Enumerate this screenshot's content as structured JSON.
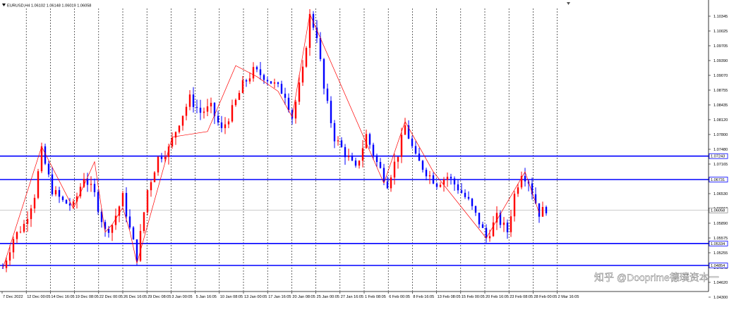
{
  "window": {
    "symbol_line": "EURUSD,H4 1.06102 1.06148 1.06019 1.06058",
    "menu_icon": "triangle-down-icon"
  },
  "colors": {
    "bull": "#ff0000",
    "bear": "#0000ff",
    "zigzag": "#ff0000",
    "level_line": "#0000ff",
    "grid": "#000000",
    "background": "#ffffff"
  },
  "price_axis": {
    "ticks": [
      "1.10345",
      "1.10025",
      "1.09705",
      "1.09390",
      "1.09070",
      "1.08755",
      "1.08435",
      "1.08120",
      "1.07800",
      "1.07480",
      "1.07165",
      "1.06845",
      "1.06530",
      "1.06210",
      "1.05890",
      "1.05575",
      "1.05255",
      "1.04940",
      "1.04620",
      "1.04300"
    ]
  },
  "time_axis": {
    "ticks": [
      "7 Dec 2022",
      "12 Dec 00:05",
      "14 Dec 16:05",
      "19 Dec 08:05",
      "22 Dec 00:05",
      "26 Dec 16:05",
      "29 Dec 08:05",
      "3 Jan 00:05",
      "5 Jan 16:05",
      "10 Jan 08:05",
      "13 Jan 00:05",
      "17 Jan 16:05",
      "20 Jan 08:05",
      "25 Jan 00:05",
      "27 Jan 16:05",
      "1 Feb 08:05",
      "6 Feb 00:05",
      "8 Feb 16:05",
      "13 Feb 08:05",
      "15 Feb 00:05",
      "20 Feb 16:05",
      "23 Feb 08:05",
      "28 Feb 00:05",
      "2 Mar 16:05"
    ]
  },
  "levels": [
    {
      "label": "1.07243",
      "price": 1.07243
    },
    {
      "label": "1.06731",
      "price": 1.06731
    },
    {
      "label": "1.05334",
      "price": 1.05334
    },
    {
      "label": "1.04854",
      "price": 1.04854
    }
  ],
  "current_price": {
    "label": "1.06058",
    "price": 1.06058
  },
  "watermark": "知乎 @Dooprime德璞资本一",
  "chart_data": {
    "type": "candlestick",
    "symbol": "EURUSD",
    "timeframe": "H4",
    "ohlc_header": {
      "open": 1.06102,
      "high": 1.06148,
      "low": 1.06019,
      "close": 1.06058
    },
    "ylim": [
      1.043,
      1.1047
    ],
    "price_path": [
      [
        0,
        1.048
      ],
      [
        3,
        1.0545
      ],
      [
        6,
        1.0575
      ],
      [
        9,
        1.064
      ],
      [
        11,
        1.0735
      ],
      [
        14,
        1.065
      ],
      [
        17,
        1.0625
      ],
      [
        20,
        1.0615
      ],
      [
        23,
        1.068
      ],
      [
        26,
        1.064
      ],
      [
        29,
        1.056
      ],
      [
        31,
        1.0575
      ],
      [
        34,
        1.0635
      ],
      [
        36,
        1.0565
      ],
      [
        38,
        1.0505
      ],
      [
        41,
        1.065
      ],
      [
        44,
        1.072
      ],
      [
        47,
        1.074
      ],
      [
        50,
        1.08
      ],
      [
        53,
        1.085
      ],
      [
        56,
        1.082
      ],
      [
        59,
        1.083
      ],
      [
        62,
        1.078
      ],
      [
        65,
        1.0825
      ],
      [
        68,
        1.088
      ],
      [
        71,
        1.091
      ],
      [
        74,
        1.09
      ],
      [
        77,
        1.088
      ],
      [
        80,
        1.086
      ],
      [
        82,
        1.081
      ],
      [
        85,
        1.091
      ],
      [
        87,
        1.103
      ],
      [
        89,
        1.099
      ],
      [
        91,
        1.087
      ],
      [
        94,
        1.0765
      ],
      [
        97,
        1.073
      ],
      [
        100,
        1.0695
      ],
      [
        103,
        1.077
      ],
      [
        106,
        1.071
      ],
      [
        109,
        1.0665
      ],
      [
        112,
        1.073
      ],
      [
        114,
        1.079
      ],
      [
        117,
        1.072
      ],
      [
        120,
        1.069
      ],
      [
        123,
        1.0665
      ],
      [
        126,
        1.068
      ],
      [
        129,
        1.0655
      ],
      [
        132,
        1.0625
      ],
      [
        135,
        1.058
      ],
      [
        137,
        1.0545
      ],
      [
        140,
        1.059
      ],
      [
        143,
        1.056
      ],
      [
        145,
        1.064
      ],
      [
        147,
        1.069
      ],
      [
        149,
        1.067
      ],
      [
        152,
        1.06
      ],
      [
        154,
        1.061
      ]
    ],
    "zigzag": [
      [
        0,
        1.0479
      ],
      [
        11,
        1.0745
      ],
      [
        20,
        1.061
      ],
      [
        26,
        1.0712
      ],
      [
        29,
        1.0558
      ],
      [
        31,
        1.0575
      ],
      [
        34,
        1.0612
      ],
      [
        36,
        1.056
      ],
      [
        38,
        1.049
      ],
      [
        48,
        1.0766
      ],
      [
        58,
        1.0778
      ],
      [
        66,
        1.0922
      ],
      [
        72,
        1.0898
      ],
      [
        78,
        1.0866
      ],
      [
        82,
        1.081
      ],
      [
        87,
        1.1035
      ],
      [
        108,
        1.0665
      ],
      [
        114,
        1.08
      ],
      [
        122,
        1.069
      ],
      [
        137,
        1.0545
      ],
      [
        148,
        1.069
      ],
      [
        152,
        1.06
      ]
    ]
  }
}
